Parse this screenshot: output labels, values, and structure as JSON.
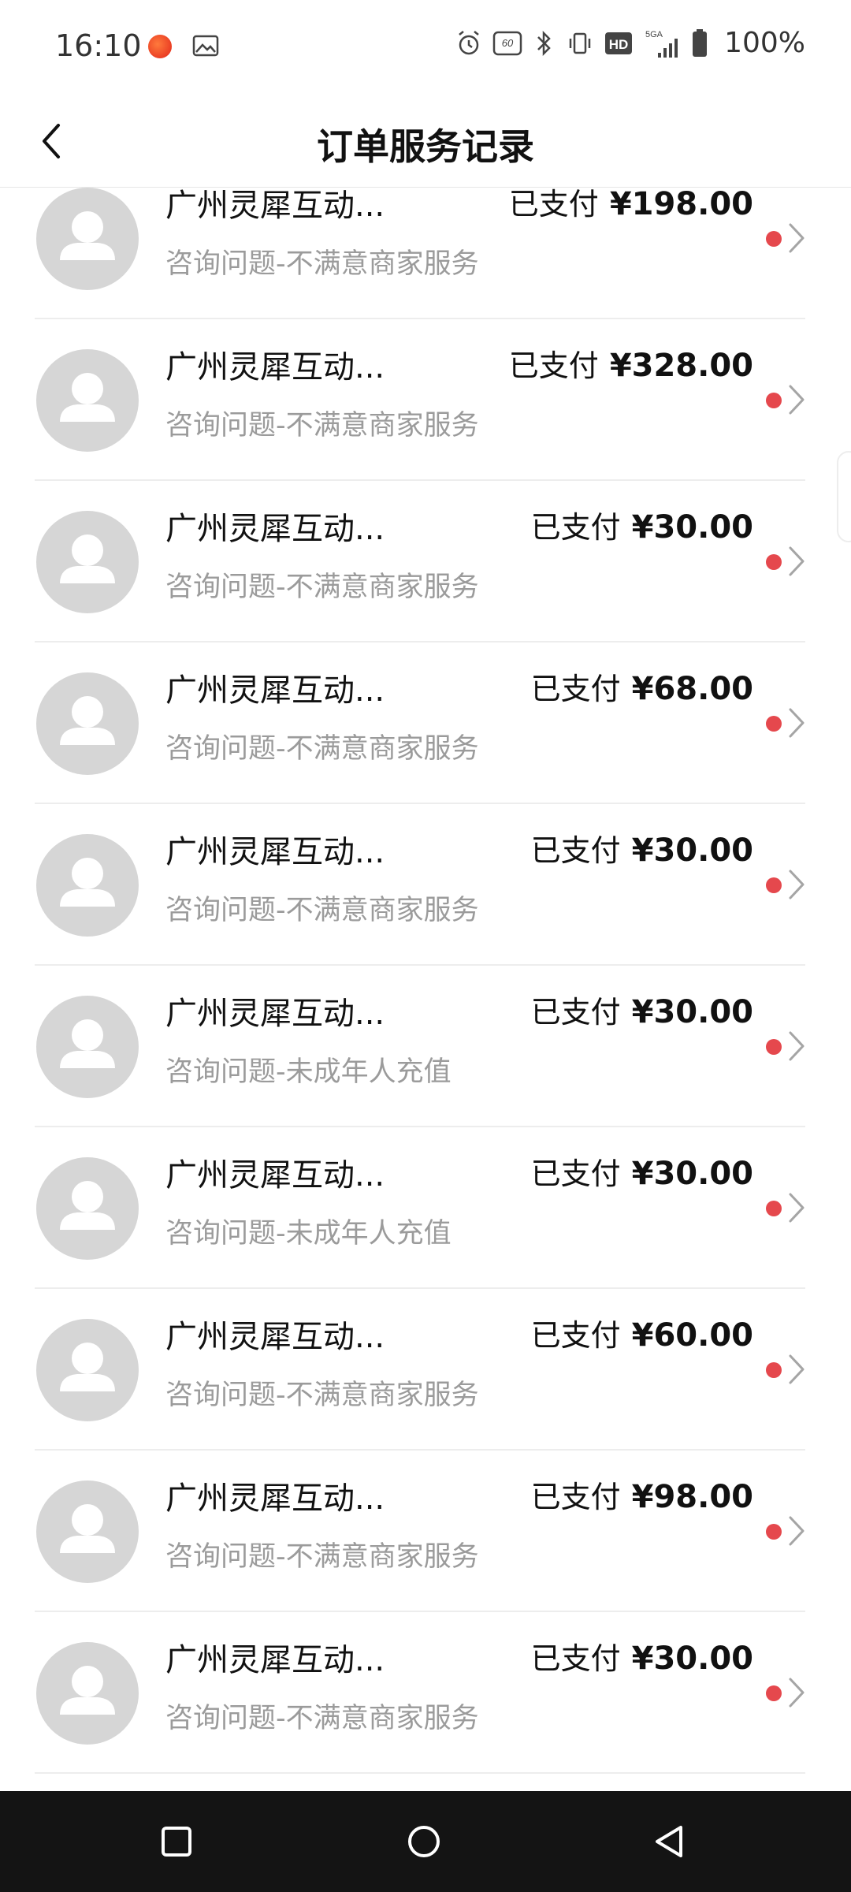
{
  "status_bar": {
    "time": "16:10",
    "battery_text": "100%",
    "icons": [
      "app-notification-icon",
      "gallery-icon",
      "alarm-icon",
      "refresh-rate-60hz-icon",
      "bluetooth-icon",
      "vibrate-icon",
      "hd-icon",
      "signal-5ga-icon",
      "battery-icon"
    ],
    "hd_label": "HD",
    "refresh_label": "60",
    "network_label": "5GA"
  },
  "header": {
    "title": "订单服务记录",
    "back_icon": "chevron-left-icon"
  },
  "colors": {
    "dot": "#e5484d",
    "subtitle": "#9b9b9b",
    "avatar_bg": "#d6d6d6",
    "nav_bg": "#141414"
  },
  "orders": [
    {
      "merchant": "广州灵犀互动...",
      "topic": "咨询问题-不满意商家服务",
      "status": "已支付",
      "amount": "¥198.00"
    },
    {
      "merchant": "广州灵犀互动...",
      "topic": "咨询问题-不满意商家服务",
      "status": "已支付",
      "amount": "¥328.00"
    },
    {
      "merchant": "广州灵犀互动...",
      "topic": "咨询问题-不满意商家服务",
      "status": "已支付",
      "amount": "¥30.00"
    },
    {
      "merchant": "广州灵犀互动...",
      "topic": "咨询问题-不满意商家服务",
      "status": "已支付",
      "amount": "¥68.00"
    },
    {
      "merchant": "广州灵犀互动...",
      "topic": "咨询问题-不满意商家服务",
      "status": "已支付",
      "amount": "¥30.00"
    },
    {
      "merchant": "广州灵犀互动...",
      "topic": "咨询问题-未成年人充值",
      "status": "已支付",
      "amount": "¥30.00"
    },
    {
      "merchant": "广州灵犀互动...",
      "topic": "咨询问题-未成年人充值",
      "status": "已支付",
      "amount": "¥30.00"
    },
    {
      "merchant": "广州灵犀互动...",
      "topic": "咨询问题-不满意商家服务",
      "status": "已支付",
      "amount": "¥60.00"
    },
    {
      "merchant": "广州灵犀互动...",
      "topic": "咨询问题-不满意商家服务",
      "status": "已支付",
      "amount": "¥98.00"
    },
    {
      "merchant": "广州灵犀互动...",
      "topic": "咨询问题-不满意商家服务",
      "status": "已支付",
      "amount": "¥30.00"
    }
  ],
  "nav_bar": {
    "buttons": [
      "recent-apps-icon",
      "home-icon",
      "back-icon"
    ]
  }
}
